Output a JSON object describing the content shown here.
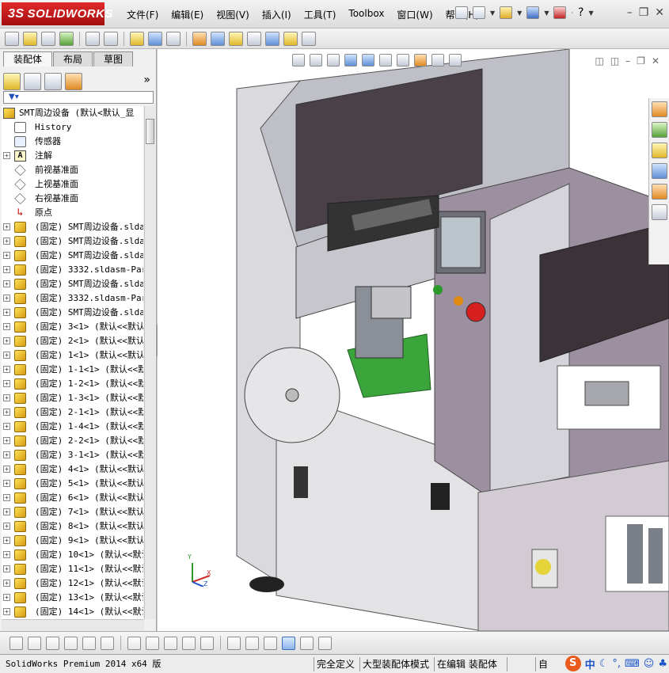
{
  "app": {
    "logo_ds": "3S",
    "logo_text": "SOLIDWORKS"
  },
  "menu": [
    "文件(F)",
    "编辑(E)",
    "视图(V)",
    "插入(I)",
    "工具(T)",
    "Toolbox",
    "窗口(W)",
    "帮助(H)"
  ],
  "title_tools": {
    "help": "?"
  },
  "left_panel": {
    "tabs": [
      "装配体",
      "布局",
      "草图"
    ],
    "expand_glyph": "»",
    "filter_glyph": "▼▾",
    "tree": [
      {
        "label": "SMT周边设备  (默认<默认_显",
        "icon": "assembly-root-icon",
        "top": true
      },
      {
        "label": "History",
        "icon": "history-icon"
      },
      {
        "label": "传感器",
        "icon": "sensor-icon"
      },
      {
        "label": "注解",
        "icon": "annotation-icon",
        "expander": "+"
      },
      {
        "label": "前视基准面",
        "icon": "plane-icon"
      },
      {
        "label": "上视基准面",
        "icon": "plane-icon"
      },
      {
        "label": "右视基准面",
        "icon": "plane-icon"
      },
      {
        "label": "原点",
        "icon": "origin-icon"
      },
      {
        "label": "(固定) SMT周边设备.slda",
        "icon": "assembly-icon",
        "expander": "+"
      },
      {
        "label": "(固定) SMT周边设备.slda",
        "icon": "assembly-icon",
        "expander": "+"
      },
      {
        "label": "(固定) SMT周边设备.slda",
        "icon": "assembly-icon",
        "expander": "+"
      },
      {
        "label": "(固定) 3332.sldasm-Part",
        "icon": "assembly-icon",
        "expander": "+"
      },
      {
        "label": "(固定) SMT周边设备.slda",
        "icon": "assembly-icon",
        "expander": "+"
      },
      {
        "label": "(固定) 3332.sldasm-Part",
        "icon": "assembly-icon",
        "expander": "+"
      },
      {
        "label": "(固定) SMT周边设备.slda",
        "icon": "assembly-icon",
        "expander": "+"
      },
      {
        "label": "(固定) 3<1> (默认<<默认",
        "icon": "assembly-icon",
        "expander": "+"
      },
      {
        "label": "(固定) 2<1> (默认<<默认",
        "icon": "assembly-icon",
        "expander": "+"
      },
      {
        "label": "(固定) 1<1> (默认<<默认",
        "icon": "assembly-icon",
        "expander": "+"
      },
      {
        "label": "(固定) 1-1<1> (默认<<默",
        "icon": "assembly-icon",
        "expander": "+"
      },
      {
        "label": "(固定) 1-2<1> (默认<<默",
        "icon": "assembly-icon",
        "expander": "+"
      },
      {
        "label": "(固定) 1-3<1> (默认<<默",
        "icon": "assembly-icon",
        "expander": "+"
      },
      {
        "label": "(固定) 2-1<1> (默认<<默",
        "icon": "assembly-icon",
        "expander": "+"
      },
      {
        "label": "(固定) 1-4<1> (默认<<默",
        "icon": "assembly-icon",
        "expander": "+"
      },
      {
        "label": "(固定) 2-2<1> (默认<<默",
        "icon": "assembly-icon",
        "expander": "+"
      },
      {
        "label": "(固定) 3-1<1> (默认<<默",
        "icon": "assembly-icon",
        "expander": "+"
      },
      {
        "label": "(固定) 4<1> (默认<<默认",
        "icon": "assembly-icon",
        "expander": "+"
      },
      {
        "label": "(固定) 5<1> (默认<<默认",
        "icon": "assembly-icon",
        "expander": "+"
      },
      {
        "label": "(固定) 6<1> (默认<<默认",
        "icon": "assembly-icon",
        "expander": "+"
      },
      {
        "label": "(固定) 7<1> (默认<<默认",
        "icon": "assembly-icon",
        "expander": "+"
      },
      {
        "label": "(固定) 8<1> (默认<<默认",
        "icon": "assembly-icon",
        "expander": "+"
      },
      {
        "label": "(固定) 9<1> (默认<<默认",
        "icon": "assembly-icon",
        "expander": "+"
      },
      {
        "label": "(固定) 10<1> (默认<<默认",
        "icon": "assembly-icon",
        "expander": "+"
      },
      {
        "label": "(固定) 11<1> (默认<<默认",
        "icon": "assembly-icon",
        "expander": "+"
      },
      {
        "label": "(固定) 12<1> (默认<<默认",
        "icon": "assembly-icon",
        "expander": "+"
      },
      {
        "label": "(固定) 13<1> (默认<<默认",
        "icon": "assembly-icon",
        "expander": "+"
      },
      {
        "label": "(固定) 14<1> (默认<<默认",
        "icon": "assembly-icon",
        "expander": "+"
      }
    ]
  },
  "viewport": {
    "triad": {
      "x": "X",
      "y": "Y",
      "z": "Z"
    }
  },
  "statusbar": {
    "app": "SolidWorks Premium 2014 x64 版",
    "defined": "完全定义",
    "mode": "大型装配体模式",
    "editing": "在编辑 装配体",
    "custom": "自",
    "ime_label": "中",
    "ime_s": "S"
  },
  "colors": {
    "logo_red": "#c81e1e",
    "machine_frame": "#c9c9cf",
    "machine_panel": "#7c6a7c",
    "feeder_green": "#3aa53a"
  }
}
